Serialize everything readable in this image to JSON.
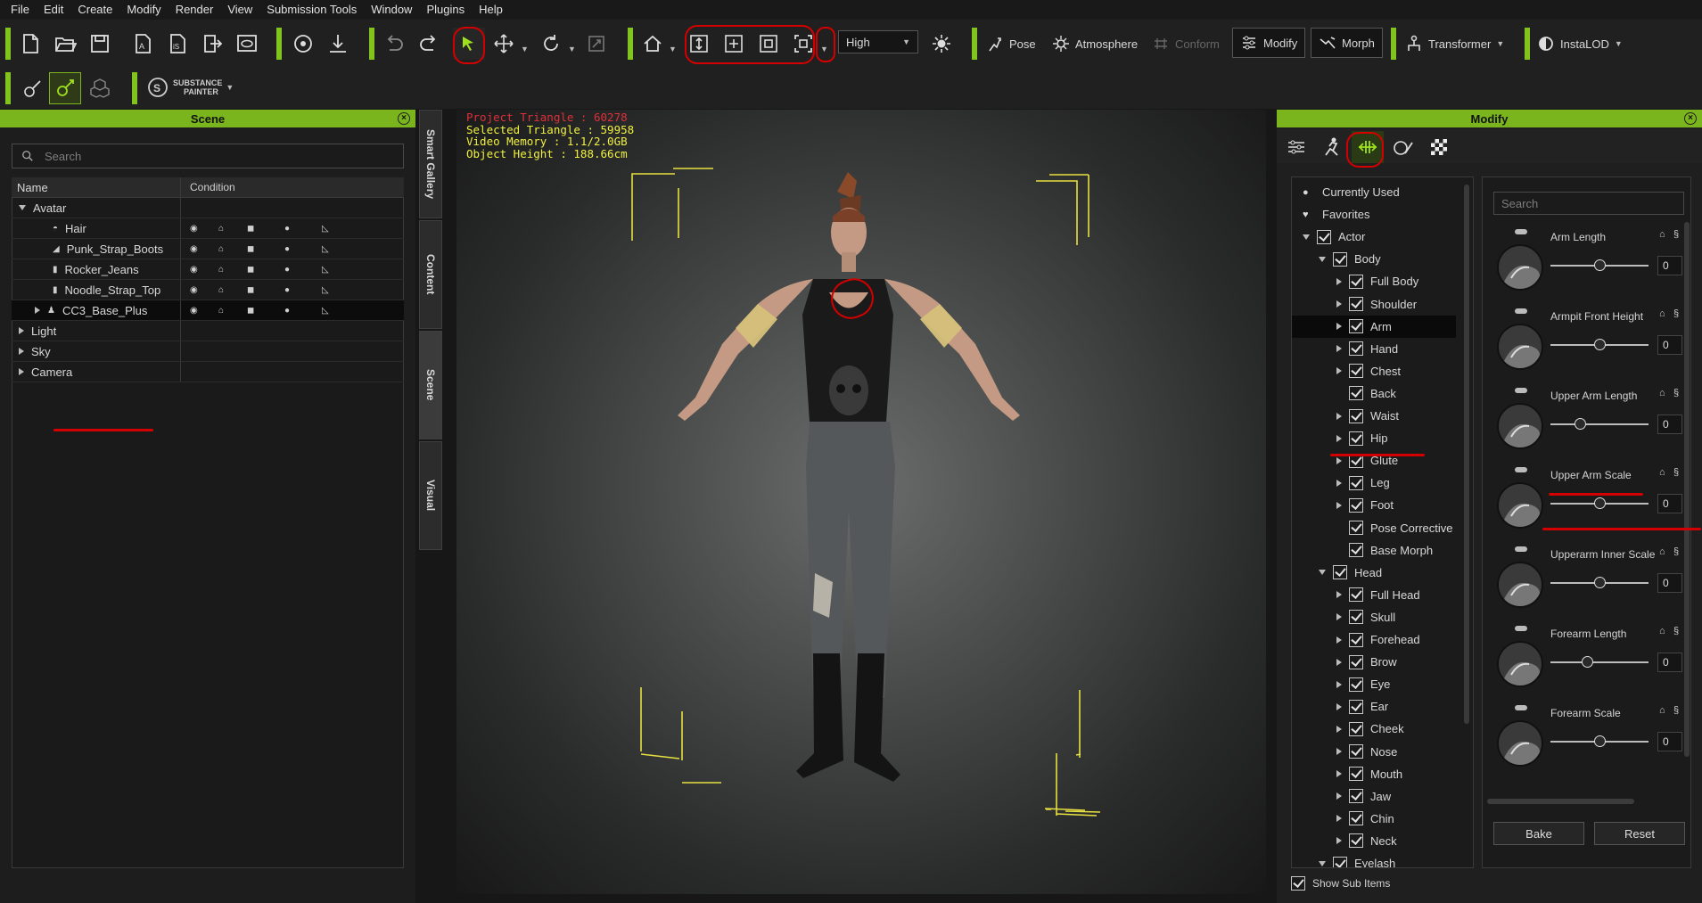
{
  "menu": [
    "File",
    "Edit",
    "Create",
    "Modify",
    "Render",
    "View",
    "Submission Tools",
    "Window",
    "Plugins",
    "Help"
  ],
  "toolbar": {
    "quality": "High",
    "pose": "Pose",
    "atmosphere": "Atmosphere",
    "conform": "Conform",
    "modify": "Modify",
    "morph": "Morph",
    "transformer": "Transformer",
    "instalod": "InstaLOD",
    "substance_line1": "SUBSTANCE",
    "substance_line2": "PAINTER"
  },
  "scene": {
    "title": "Scene",
    "search_placeholder": "Search",
    "col_name": "Name",
    "col_condition": "Condition",
    "items": [
      {
        "label": "Avatar",
        "icon": "folder"
      },
      {
        "label": "Hair",
        "icon": "hair"
      },
      {
        "label": "Punk_Strap_Boots",
        "icon": "shoe"
      },
      {
        "label": "Rocker_Jeans",
        "icon": "pants"
      },
      {
        "label": "Noodle_Strap_Top",
        "icon": "shirt"
      },
      {
        "label": "CC3_Base_Plus",
        "icon": "person"
      },
      {
        "label": "Light",
        "icon": "folder"
      },
      {
        "label": "Sky",
        "icon": "folder"
      },
      {
        "label": "Camera",
        "icon": "folder"
      }
    ]
  },
  "side_tabs": [
    "Smart Gallery",
    "Content",
    "Scene",
    "Visual"
  ],
  "viewport": {
    "stat1": "Project Triangle : 60278",
    "stat2": "Selected Triangle : 59958",
    "stat3": "Video Memory : 1.1/2.0GB",
    "stat4": "Object Height : 188.66cm"
  },
  "modify": {
    "title": "Modify",
    "search_placeholder": "Search",
    "tree": [
      {
        "label": "Currently Used",
        "level": 0,
        "kind": "dot"
      },
      {
        "label": "Favorites",
        "level": 0,
        "kind": "heart"
      },
      {
        "label": "Actor",
        "level": 0,
        "kind": "open"
      },
      {
        "label": "Body",
        "level": 1,
        "kind": "open"
      },
      {
        "label": "Full Body",
        "level": 2,
        "kind": "closed"
      },
      {
        "label": "Shoulder",
        "level": 2,
        "kind": "closed"
      },
      {
        "label": "Arm",
        "level": 2,
        "kind": "closed",
        "selected": true
      },
      {
        "label": "Hand",
        "level": 2,
        "kind": "closed"
      },
      {
        "label": "Chest",
        "level": 2,
        "kind": "closed"
      },
      {
        "label": "Back",
        "level": 2,
        "kind": "leaf"
      },
      {
        "label": "Waist",
        "level": 2,
        "kind": "closed"
      },
      {
        "label": "Hip",
        "level": 2,
        "kind": "closed"
      },
      {
        "label": "Glute",
        "level": 2,
        "kind": "closed"
      },
      {
        "label": "Leg",
        "level": 2,
        "kind": "closed"
      },
      {
        "label": "Foot",
        "level": 2,
        "kind": "closed"
      },
      {
        "label": "Pose Corrective",
        "level": 2,
        "kind": "leaf"
      },
      {
        "label": "Base Morph",
        "level": 2,
        "kind": "leaf"
      },
      {
        "label": "Head",
        "level": 1,
        "kind": "open"
      },
      {
        "label": "Full Head",
        "level": 2,
        "kind": "closed"
      },
      {
        "label": "Skull",
        "level": 2,
        "kind": "closed"
      },
      {
        "label": "Forehead",
        "level": 2,
        "kind": "closed"
      },
      {
        "label": "Brow",
        "level": 2,
        "kind": "closed"
      },
      {
        "label": "Eye",
        "level": 2,
        "kind": "closed"
      },
      {
        "label": "Ear",
        "level": 2,
        "kind": "closed"
      },
      {
        "label": "Cheek",
        "level": 2,
        "kind": "closed"
      },
      {
        "label": "Nose",
        "level": 2,
        "kind": "closed"
      },
      {
        "label": "Mouth",
        "level": 2,
        "kind": "closed"
      },
      {
        "label": "Jaw",
        "level": 2,
        "kind": "closed"
      },
      {
        "label": "Chin",
        "level": 2,
        "kind": "closed"
      },
      {
        "label": "Neck",
        "level": 2,
        "kind": "closed"
      },
      {
        "label": "Eyelash",
        "level": 1,
        "kind": "open"
      }
    ],
    "sliders": [
      {
        "label": "Arm Length",
        "value": "0",
        "pos": 0.5
      },
      {
        "label": "Armpit Front Height",
        "value": "0",
        "pos": 0.5
      },
      {
        "label": "Upper Arm Length",
        "value": "0",
        "pos": 0.3
      },
      {
        "label": "Upper Arm Scale",
        "value": "0",
        "pos": 0.5
      },
      {
        "label": "Upperarm Inner Scale",
        "value": "0",
        "pos": 0.5
      },
      {
        "label": "Forearm Length",
        "value": "0",
        "pos": 0.37
      },
      {
        "label": "Forearm Scale",
        "value": "0",
        "pos": 0.5
      }
    ],
    "bake": "Bake",
    "reset": "Reset",
    "show_sub_items": "Show Sub Items"
  }
}
